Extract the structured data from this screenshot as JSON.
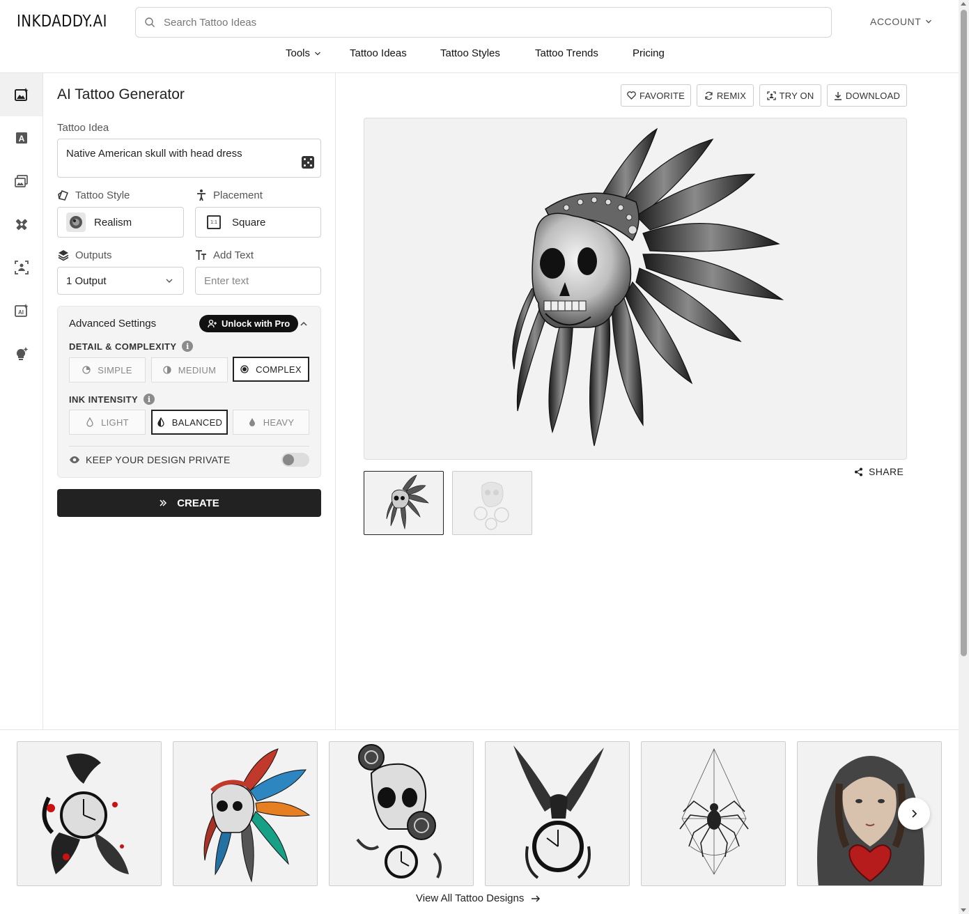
{
  "brand": {
    "logo": "INKDADDY.AI"
  },
  "search": {
    "placeholder": "Search Tattoo Ideas"
  },
  "account": {
    "label": "ACCOUNT"
  },
  "nav": {
    "items": [
      "Tools",
      "Tattoo Ideas",
      "Tattoo Styles",
      "Tattoo Trends",
      "Pricing"
    ]
  },
  "rail": {
    "icons": [
      "image-generator-icon",
      "text-letter-icon",
      "gallery-icon",
      "tattoo-tool-icon",
      "try-on-scan-icon",
      "ai-image-icon",
      "idea-bulb-icon"
    ],
    "active_index": 0
  },
  "form": {
    "title": "AI Tattoo Generator",
    "idea_label": "Tattoo Idea",
    "idea_value": "Native American skull with head dress",
    "style_label": "Tattoo Style",
    "style_value": "Realism",
    "placement_label": "Placement",
    "placement_value": "Square",
    "placement_badge": "1:1",
    "outputs_label": "Outputs",
    "outputs_value": "1 Output",
    "text_label": "Add Text",
    "text_placeholder": "Enter text",
    "advanced": {
      "title": "Advanced Settings",
      "pro_label": "Unlock with Pro",
      "detail_label": "DETAIL & COMPLEXITY",
      "detail_options": [
        "SIMPLE",
        "MEDIUM",
        "COMPLEX"
      ],
      "detail_selected": "COMPLEX",
      "ink_label": "INK INTENSITY",
      "ink_options": [
        "LIGHT",
        "BALANCED",
        "HEAVY"
      ],
      "ink_selected": "BALANCED",
      "private_label": "KEEP YOUR DESIGN PRIVATE",
      "private_on": false
    },
    "create_label": "CREATE"
  },
  "preview": {
    "actions": [
      "FAVORITE",
      "REMIX",
      "TRY ON",
      "DOWNLOAD"
    ],
    "share_label": "SHARE",
    "thumbnails": [
      "skull-headdress-thumb",
      "skull-roses-faded-thumb"
    ]
  },
  "gallery": {
    "cards": [
      "crow-clock-tattoo",
      "color-skull-headdress-tattoo",
      "skull-roses-clock-tattoo",
      "eagle-clock-tattoo",
      "geometric-spider-tattoo",
      "hooded-woman-heart-tattoo"
    ],
    "view_all_label": "View All Tattoo Designs"
  },
  "colors": {
    "accent": "#222222",
    "border": "#d0d0d0",
    "panel_bg": "#f4f4f4"
  }
}
